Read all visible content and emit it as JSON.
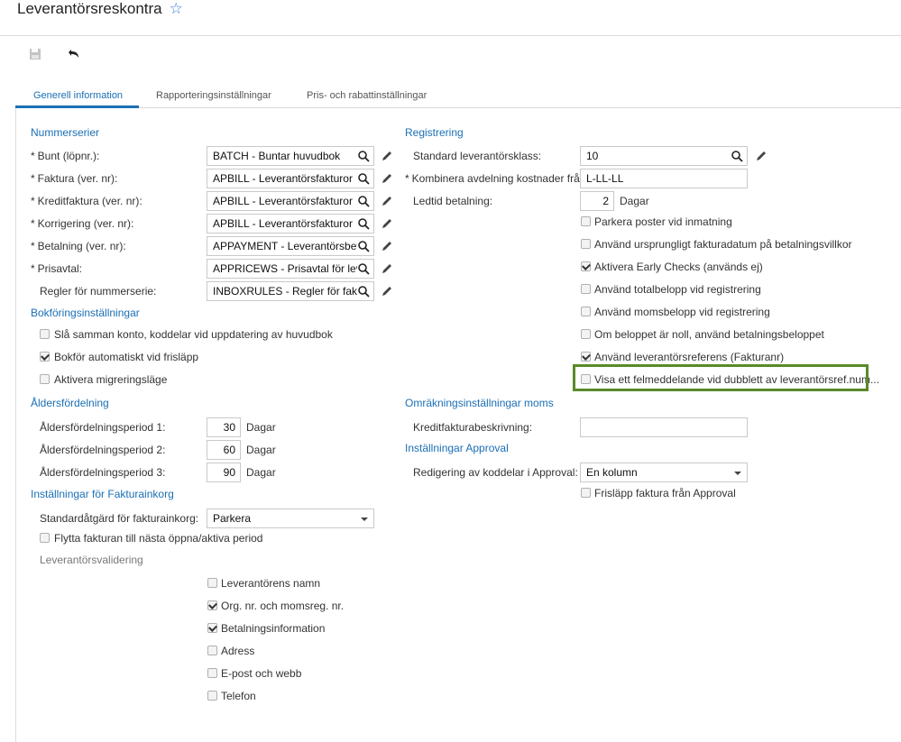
{
  "page": {
    "title": "Leverantörsreskontra",
    "star_icon": "star-icon"
  },
  "toolbar": {
    "save_icon": "save-icon",
    "undo_icon": "undo-icon"
  },
  "tabs": [
    {
      "label": "Generell information",
      "active": true
    },
    {
      "label": "Rapporteringsinställningar",
      "active": false
    },
    {
      "label": "Pris- och rabattinställningar",
      "active": false
    }
  ],
  "left": {
    "nummerserier": {
      "heading": "Nummerserier",
      "rows": [
        {
          "label": "Bunt (löpnr.):",
          "required": true,
          "value": "BATCH - Buntar huvudbok"
        },
        {
          "label": "Faktura (ver. nr):",
          "required": true,
          "value": "APBILL - Leverantörsfakturor"
        },
        {
          "label": "Kreditfaktura (ver. nr):",
          "required": true,
          "value": "APBILL - Leverantörsfakturor"
        },
        {
          "label": "Korrigering (ver. nr):",
          "required": true,
          "value": "APBILL - Leverantörsfakturor"
        },
        {
          "label": "Betalning (ver. nr):",
          "required": true,
          "value": "APPAYMENT - Leverantörsbeta"
        },
        {
          "label": "Prisavtal:",
          "required": true,
          "value": "APPRICEWS - Prisavtal för leve"
        },
        {
          "label": "Regler för nummerserie:",
          "required": false,
          "value": "INBOXRULES - Regler för faktu"
        }
      ]
    },
    "bokforing": {
      "heading": "Bokföringsinställningar",
      "items": [
        {
          "label": "Slå samman konto, koddelar vid uppdatering av huvudbok",
          "checked": false
        },
        {
          "label": "Bokför automatiskt vid frisläpp",
          "checked": true
        },
        {
          "label": "Aktivera migreringsläge",
          "checked": false
        }
      ]
    },
    "alders": {
      "heading": "Åldersfördelning",
      "rows": [
        {
          "label": "Åldersfördelningsperiod 1:",
          "value": "30",
          "unit": "Dagar"
        },
        {
          "label": "Åldersfördelningsperiod 2:",
          "value": "60",
          "unit": "Dagar"
        },
        {
          "label": "Åldersfördelningsperiod 3:",
          "value": "90",
          "unit": "Dagar"
        }
      ]
    },
    "fakturainkorg": {
      "heading": "Inställningar för Fakturainkorg",
      "standard_label": "Standardåtgärd för fakturainkorg:",
      "standard_value": "Parkera",
      "flytta_label": "Flytta fakturan till nästa öppna/aktiva period",
      "flytta_checked": false,
      "validering_label": "Leverantörsvalidering",
      "validering_items": [
        {
          "label": "Leverantörens namn",
          "checked": false
        },
        {
          "label": "Org. nr. och momsreg. nr.",
          "checked": true
        },
        {
          "label": "Betalningsinformation",
          "checked": true
        },
        {
          "label": "Adress",
          "checked": false
        },
        {
          "label": "E-post och webb",
          "checked": false
        },
        {
          "label": "Telefon",
          "checked": false
        }
      ]
    }
  },
  "right": {
    "registrering": {
      "heading": "Registrering",
      "standard_label": "Standard leverantörsklass:",
      "standard_value": "10",
      "kombinera_label": "Kombinera avdelning kostnader från:",
      "kombinera_value": "L-LL-LL",
      "ledtid_label": "Ledtid betalning:",
      "ledtid_value": "2",
      "ledtid_unit": "Dagar",
      "items": [
        {
          "label": "Parkera poster vid inmatning",
          "checked": false
        },
        {
          "label": "Använd ursprungligt fakturadatum på betalningsvillkor",
          "checked": false
        },
        {
          "label": "Aktivera Early Checks (används ej)",
          "checked": true
        },
        {
          "label": "Använd totalbelopp vid registrering",
          "checked": false
        },
        {
          "label": "Använd momsbelopp vid registrering",
          "checked": false
        },
        {
          "label": "Om beloppet är noll, använd betalningsbeloppet",
          "checked": false
        },
        {
          "label": "Använd leverantörsreferens (Fakturanr)",
          "checked": true
        },
        {
          "label": "Visa ett felmeddelande vid dubblett av leverantörsref.num...",
          "checked": false
        }
      ]
    },
    "omrakning": {
      "heading": "Omräkningsinställningar moms",
      "kredit_label": "Kreditfakturabeskrivning:",
      "kredit_value": ""
    },
    "approval": {
      "heading": "Inställningar Approval",
      "redigering_label": "Redigering av koddelar i Approval:",
      "redigering_value": "En kolumn",
      "frislapp_label": "Frisläpp faktura från Approval",
      "frislapp_checked": false
    }
  },
  "highlight_color": "#5a8a28"
}
